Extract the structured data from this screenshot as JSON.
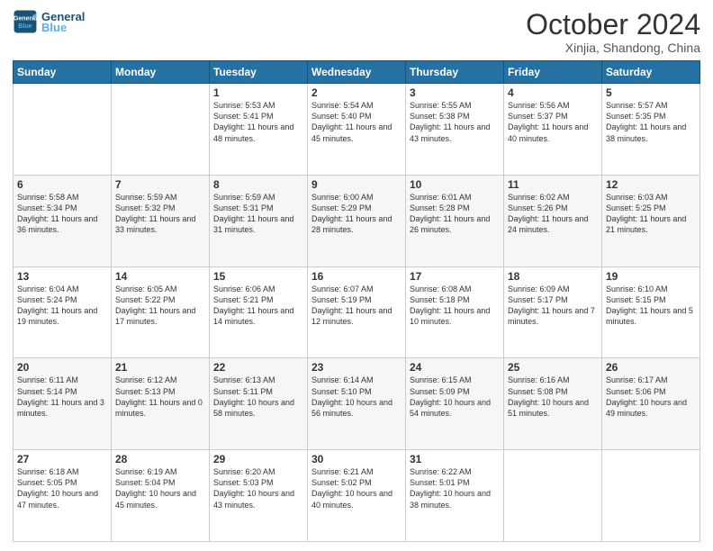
{
  "header": {
    "logo_line1": "General",
    "logo_line2": "Blue",
    "month": "October 2024",
    "location": "Xinjia, Shandong, China"
  },
  "weekdays": [
    "Sunday",
    "Monday",
    "Tuesday",
    "Wednesday",
    "Thursday",
    "Friday",
    "Saturday"
  ],
  "weeks": [
    [
      {
        "day": "",
        "info": ""
      },
      {
        "day": "",
        "info": ""
      },
      {
        "day": "1",
        "info": "Sunrise: 5:53 AM\nSunset: 5:41 PM\nDaylight: 11 hours and 48 minutes."
      },
      {
        "day": "2",
        "info": "Sunrise: 5:54 AM\nSunset: 5:40 PM\nDaylight: 11 hours and 45 minutes."
      },
      {
        "day": "3",
        "info": "Sunrise: 5:55 AM\nSunset: 5:38 PM\nDaylight: 11 hours and 43 minutes."
      },
      {
        "day": "4",
        "info": "Sunrise: 5:56 AM\nSunset: 5:37 PM\nDaylight: 11 hours and 40 minutes."
      },
      {
        "day": "5",
        "info": "Sunrise: 5:57 AM\nSunset: 5:35 PM\nDaylight: 11 hours and 38 minutes."
      }
    ],
    [
      {
        "day": "6",
        "info": "Sunrise: 5:58 AM\nSunset: 5:34 PM\nDaylight: 11 hours and 36 minutes."
      },
      {
        "day": "7",
        "info": "Sunrise: 5:59 AM\nSunset: 5:32 PM\nDaylight: 11 hours and 33 minutes."
      },
      {
        "day": "8",
        "info": "Sunrise: 5:59 AM\nSunset: 5:31 PM\nDaylight: 11 hours and 31 minutes."
      },
      {
        "day": "9",
        "info": "Sunrise: 6:00 AM\nSunset: 5:29 PM\nDaylight: 11 hours and 28 minutes."
      },
      {
        "day": "10",
        "info": "Sunrise: 6:01 AM\nSunset: 5:28 PM\nDaylight: 11 hours and 26 minutes."
      },
      {
        "day": "11",
        "info": "Sunrise: 6:02 AM\nSunset: 5:26 PM\nDaylight: 11 hours and 24 minutes."
      },
      {
        "day": "12",
        "info": "Sunrise: 6:03 AM\nSunset: 5:25 PM\nDaylight: 11 hours and 21 minutes."
      }
    ],
    [
      {
        "day": "13",
        "info": "Sunrise: 6:04 AM\nSunset: 5:24 PM\nDaylight: 11 hours and 19 minutes."
      },
      {
        "day": "14",
        "info": "Sunrise: 6:05 AM\nSunset: 5:22 PM\nDaylight: 11 hours and 17 minutes."
      },
      {
        "day": "15",
        "info": "Sunrise: 6:06 AM\nSunset: 5:21 PM\nDaylight: 11 hours and 14 minutes."
      },
      {
        "day": "16",
        "info": "Sunrise: 6:07 AM\nSunset: 5:19 PM\nDaylight: 11 hours and 12 minutes."
      },
      {
        "day": "17",
        "info": "Sunrise: 6:08 AM\nSunset: 5:18 PM\nDaylight: 11 hours and 10 minutes."
      },
      {
        "day": "18",
        "info": "Sunrise: 6:09 AM\nSunset: 5:17 PM\nDaylight: 11 hours and 7 minutes."
      },
      {
        "day": "19",
        "info": "Sunrise: 6:10 AM\nSunset: 5:15 PM\nDaylight: 11 hours and 5 minutes."
      }
    ],
    [
      {
        "day": "20",
        "info": "Sunrise: 6:11 AM\nSunset: 5:14 PM\nDaylight: 11 hours and 3 minutes."
      },
      {
        "day": "21",
        "info": "Sunrise: 6:12 AM\nSunset: 5:13 PM\nDaylight: 11 hours and 0 minutes."
      },
      {
        "day": "22",
        "info": "Sunrise: 6:13 AM\nSunset: 5:11 PM\nDaylight: 10 hours and 58 minutes."
      },
      {
        "day": "23",
        "info": "Sunrise: 6:14 AM\nSunset: 5:10 PM\nDaylight: 10 hours and 56 minutes."
      },
      {
        "day": "24",
        "info": "Sunrise: 6:15 AM\nSunset: 5:09 PM\nDaylight: 10 hours and 54 minutes."
      },
      {
        "day": "25",
        "info": "Sunrise: 6:16 AM\nSunset: 5:08 PM\nDaylight: 10 hours and 51 minutes."
      },
      {
        "day": "26",
        "info": "Sunrise: 6:17 AM\nSunset: 5:06 PM\nDaylight: 10 hours and 49 minutes."
      }
    ],
    [
      {
        "day": "27",
        "info": "Sunrise: 6:18 AM\nSunset: 5:05 PM\nDaylight: 10 hours and 47 minutes."
      },
      {
        "day": "28",
        "info": "Sunrise: 6:19 AM\nSunset: 5:04 PM\nDaylight: 10 hours and 45 minutes."
      },
      {
        "day": "29",
        "info": "Sunrise: 6:20 AM\nSunset: 5:03 PM\nDaylight: 10 hours and 43 minutes."
      },
      {
        "day": "30",
        "info": "Sunrise: 6:21 AM\nSunset: 5:02 PM\nDaylight: 10 hours and 40 minutes."
      },
      {
        "day": "31",
        "info": "Sunrise: 6:22 AM\nSunset: 5:01 PM\nDaylight: 10 hours and 38 minutes."
      },
      {
        "day": "",
        "info": ""
      },
      {
        "day": "",
        "info": ""
      }
    ]
  ]
}
